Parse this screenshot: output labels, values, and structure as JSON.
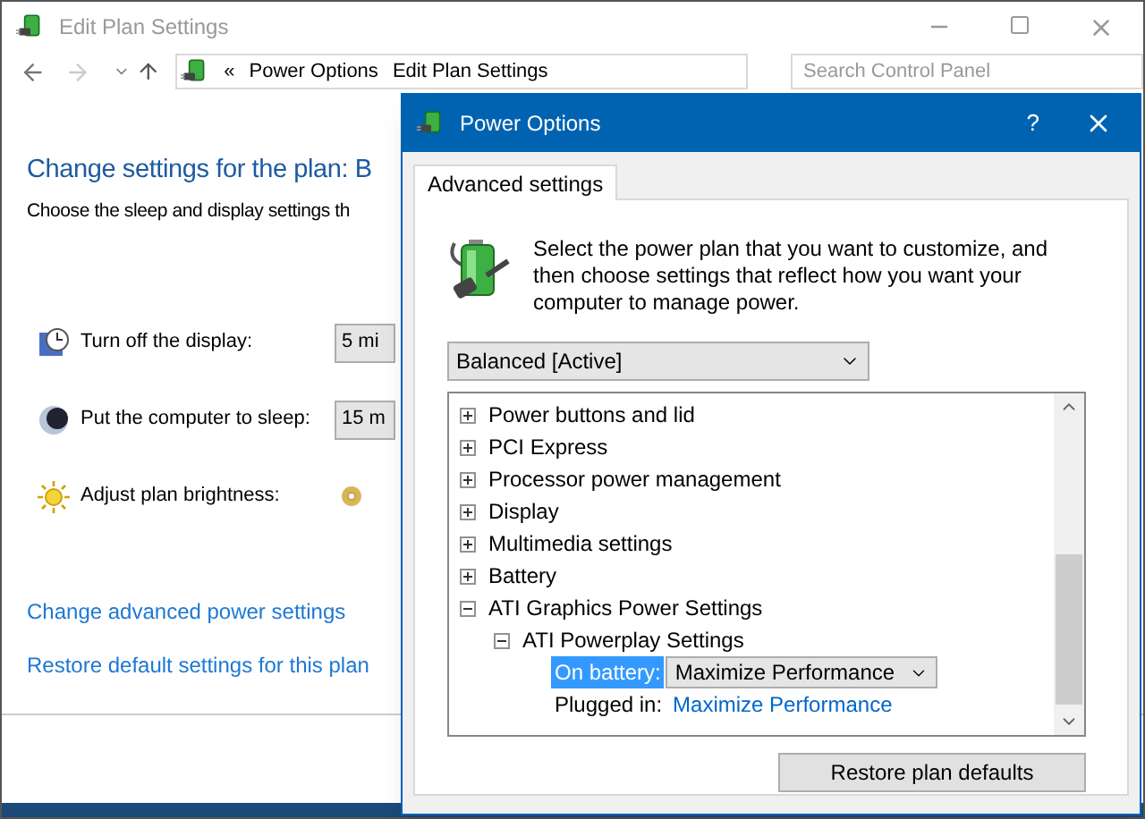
{
  "main_window": {
    "title": "Edit Plan Settings",
    "breadcrumb": [
      "«",
      "Power Options",
      "Edit Plan Settings"
    ],
    "search": {
      "placeholder": "Search Control Panel"
    },
    "heading": "Change settings for the plan: B",
    "subtitle": "Choose the sleep and display settings th",
    "settings": [
      {
        "kind": "dropdown",
        "label": "Turn off the display:",
        "value": "5 mi"
      },
      {
        "kind": "dropdown",
        "label": "Put the computer to sleep:",
        "value": "15 m"
      },
      {
        "kind": "slider",
        "label": "Adjust plan brightness:"
      }
    ],
    "links": [
      "Change advanced power settings",
      "Restore default settings for this plan"
    ]
  },
  "dialog": {
    "title": "Power Options",
    "help": "?",
    "tabs": [
      {
        "label": "Advanced settings",
        "selected": true
      }
    ],
    "description": "Select the power plan that you want to customize, and then choose settings that reflect how you want your computer to manage power.",
    "plan": "Balanced [Active]",
    "tree": [
      {
        "label": "Power buttons and lid",
        "expanded": false
      },
      {
        "label": "PCI Express",
        "expanded": false
      },
      {
        "label": "Processor power management",
        "expanded": false
      },
      {
        "label": "Display",
        "expanded": false
      },
      {
        "label": "Multimedia settings",
        "expanded": false
      },
      {
        "label": "Battery",
        "expanded": false
      },
      {
        "label": "ATI Graphics Power Settings",
        "expanded": true,
        "children": [
          {
            "label": "ATI Powerplay Settings",
            "expanded": true,
            "values": [
              {
                "label": "On battery:",
                "value": "Maximize Performance",
                "selected": true
              },
              {
                "label": "Plugged in:",
                "value": "Maximize Performance",
                "selected": false
              }
            ]
          }
        ]
      }
    ],
    "button": "Restore plan defaults"
  }
}
